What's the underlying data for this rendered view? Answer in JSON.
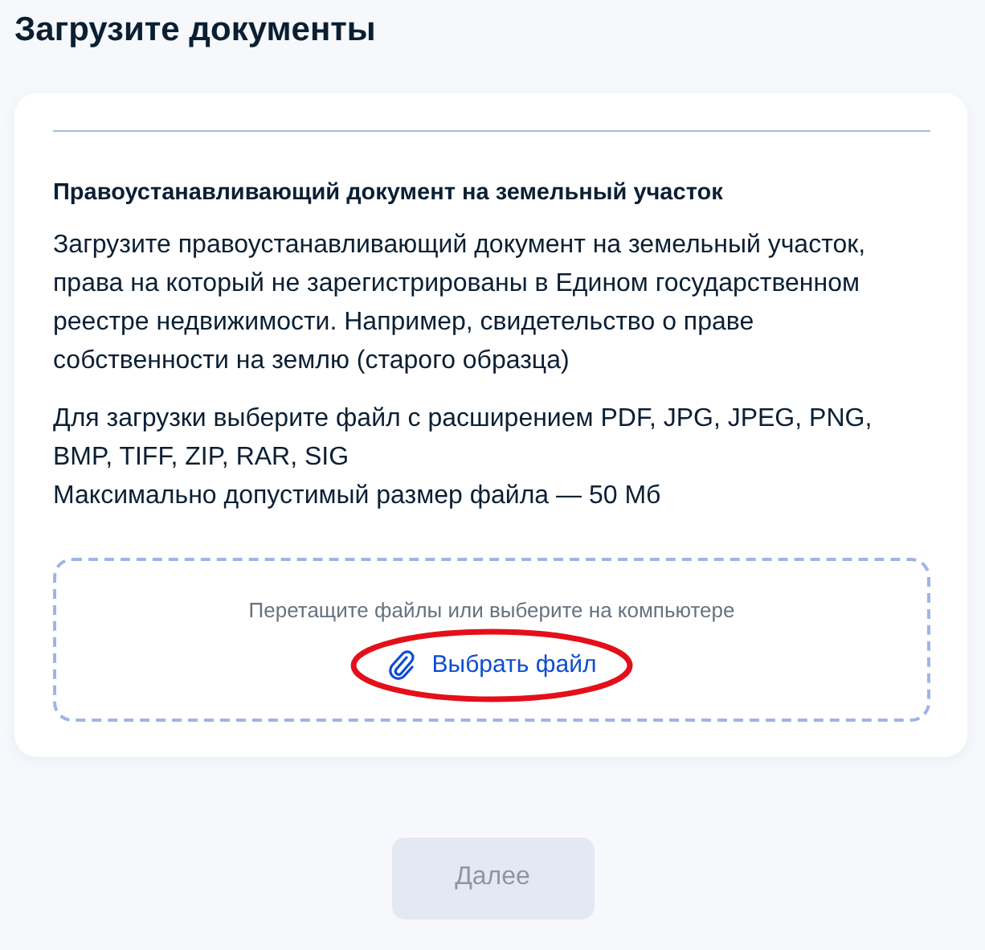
{
  "page_title": "Загрузите документы",
  "document": {
    "title": "Правоустанавливающий документ на земельный участок",
    "paragraphs": [
      "Загрузите правоустанавливающий документ на земельный участок, права на который не зарегистрированы в Едином государственном реестре недвижимости. Например, свидетельство о праве собственности на землю (старого образца)",
      "Для загрузки выберите файл с расширением PDF, JPG, JPEG, PNG, BMP, TIFF, ZIP, RAR, SIG\nМаксимально допустимый размер файла — 50 Мб"
    ]
  },
  "dropzone": {
    "hint": "Перетащите файлы или выберите на компьютере",
    "link": "Выбрать файл",
    "annotation": {
      "kind": "ellipse"
    }
  },
  "next_button": {
    "label": "Далее",
    "disabled": true
  }
}
